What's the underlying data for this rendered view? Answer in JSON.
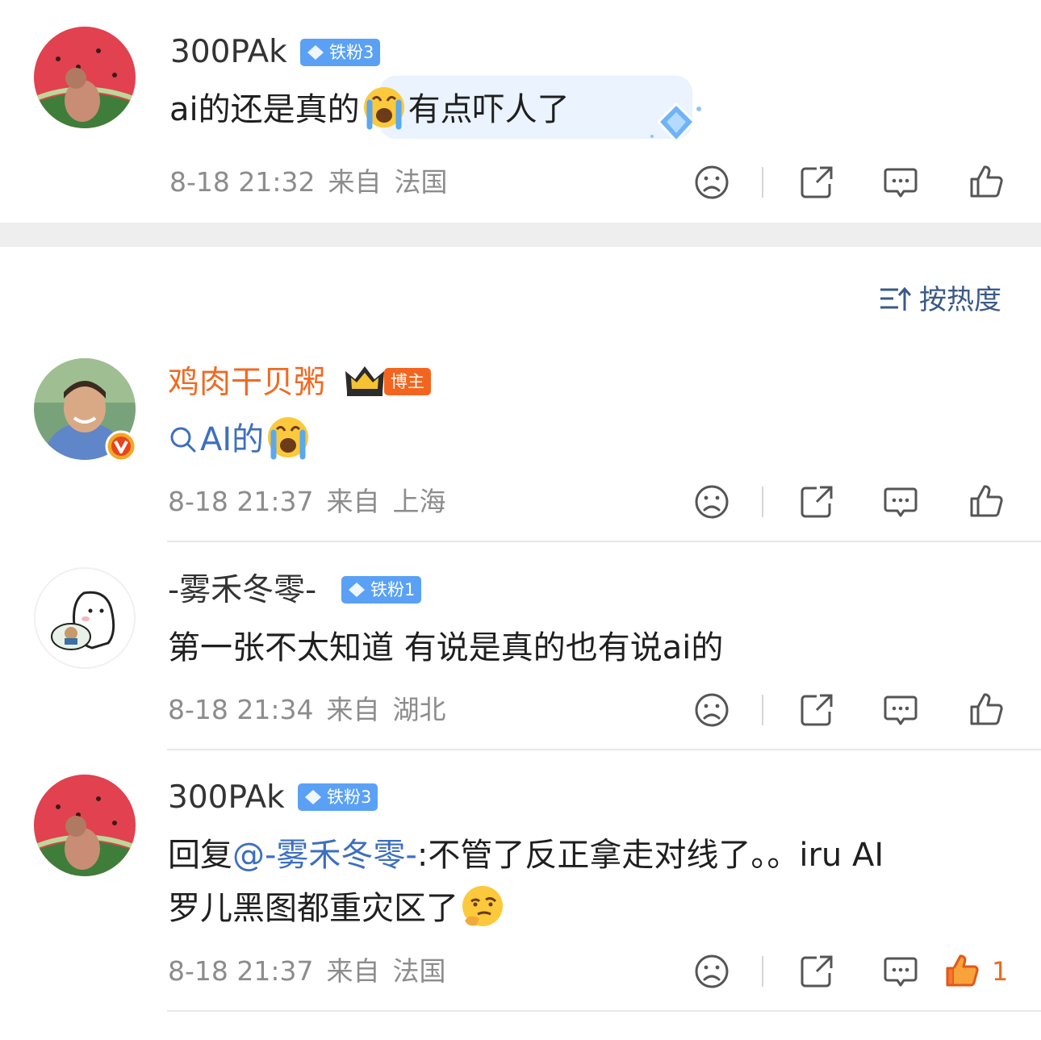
{
  "sort": {
    "label": "按热度"
  },
  "comments": [
    {
      "user": "300PAk",
      "badge": "铁粉3",
      "text_a": "ai的还是真的",
      "text_b": "有点吓人了",
      "time": "8-18 21:32",
      "from": "来自",
      "location": "法国"
    },
    {
      "user": "鸡肉干贝粥",
      "badge": "博主",
      "search_text": "AI的",
      "time": "8-18 21:37",
      "from": "来自",
      "location": "上海"
    },
    {
      "user": "-雾禾冬零-",
      "badge": "铁粉1",
      "text": "第一张不太知道 有说是真的也有说ai的",
      "time": "8-18 21:34",
      "from": "来自",
      "location": "湖北"
    },
    {
      "user": "300PAk",
      "badge": "铁粉3",
      "reply_prefix": "回复",
      "mention": "@-雾禾冬零-",
      "text_line1": ":不管了反正拿走对线了。。iru AI",
      "text_line2": "罗儿黑图都重灾区了",
      "time": "8-18 21:37",
      "from": "来自",
      "location": "法国",
      "likes": "1"
    }
  ],
  "colors": {
    "host_name": "#f06a22",
    "mention": "#3e6fbf",
    "fan_badge": "#5aa1f5",
    "host_badge": "#f3651f",
    "liked": "#f0691c"
  },
  "icons": {
    "dislike": "sad-face-icon",
    "share": "share-icon",
    "comment": "comment-icon",
    "like": "thumbs-up-icon",
    "sort": "sort-icon",
    "search": "search-icon"
  }
}
